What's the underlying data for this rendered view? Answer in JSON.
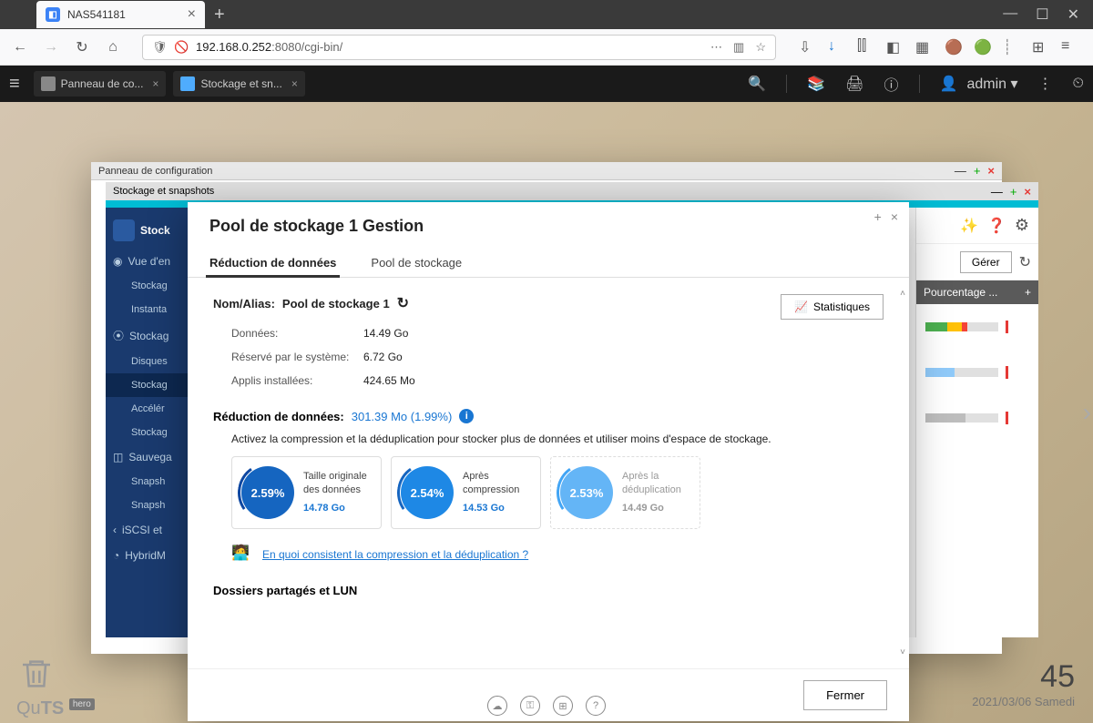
{
  "browser": {
    "tab_title": "NAS541181",
    "url_display_prefix": "192.168.0.252",
    "url_display_suffix": ":8080/cgi-bin/"
  },
  "appbar": {
    "tabs": [
      {
        "label": "Panneau de co..."
      },
      {
        "label": "Stockage et sn..."
      }
    ],
    "user": "admin ▾"
  },
  "windows": {
    "config_title": "Panneau de configuration",
    "storage_title": "Stockage et snapshots"
  },
  "sidebar": {
    "head": "Stock",
    "items": [
      {
        "type": "cat",
        "label": "Vue d'en",
        "icon": "◉"
      },
      {
        "type": "sub",
        "label": "Stockag"
      },
      {
        "type": "sub",
        "label": "Instanta"
      },
      {
        "type": "cat",
        "label": "Stockag",
        "icon": "⦿"
      },
      {
        "type": "sub",
        "label": "Disques"
      },
      {
        "type": "sub",
        "label": "Stockag",
        "active": true
      },
      {
        "type": "sub",
        "label": "Accélér"
      },
      {
        "type": "sub",
        "label": "Stockag"
      },
      {
        "type": "cat",
        "label": "Sauvega",
        "icon": "◫"
      },
      {
        "type": "sub",
        "label": "Snapsh"
      },
      {
        "type": "sub",
        "label": "Snapsh"
      },
      {
        "type": "cat",
        "label": "iSCSI et",
        "icon": "‹"
      },
      {
        "type": "cat",
        "label": "HybridM",
        "icon": "◔"
      }
    ]
  },
  "right_peek": {
    "manage_btn": "Gérer",
    "pct_header": "Pourcentage ..."
  },
  "modal": {
    "title": "Pool de stockage 1 Gestion",
    "tabs": [
      "Réduction de données",
      "Pool de stockage"
    ],
    "stats_btn": "Statistiques",
    "alias_label": "Nom/Alias:",
    "alias_value": "Pool de stockage 1",
    "info": [
      {
        "label": "Données:",
        "value": "14.49 Go"
      },
      {
        "label": "Réservé par le système:",
        "value": "6.72 Go"
      },
      {
        "label": "Applis installées:",
        "value": "424.65 Mo"
      }
    ],
    "reduc_label": "Réduction de données:",
    "reduc_value": "301.39 Mo (1.99%)",
    "reduc_desc": "Activez la compression et la déduplication pour stocker plus de données et utiliser moins d'espace de stockage.",
    "cards": [
      {
        "pct": "2.59%",
        "title": "Taille originale des données",
        "value": "14.78 Go",
        "class": "c1"
      },
      {
        "pct": "2.54%",
        "title": "Après compression",
        "value": "14.53 Go",
        "class": "c2"
      },
      {
        "pct": "2.53%",
        "title": "Après la déduplication",
        "value": "14.49 Go",
        "class": "c3",
        "grey": true
      }
    ],
    "help_link": "En quoi consistent la compression et la déduplication ?",
    "section2": "Dossiers partagés et LUN",
    "close_btn": "Fermer"
  },
  "clock": {
    "time": "45",
    "date": "2021/03/06 Samedi"
  },
  "brand": {
    "a": "Qu",
    "b": "TS",
    "c": "hero"
  }
}
